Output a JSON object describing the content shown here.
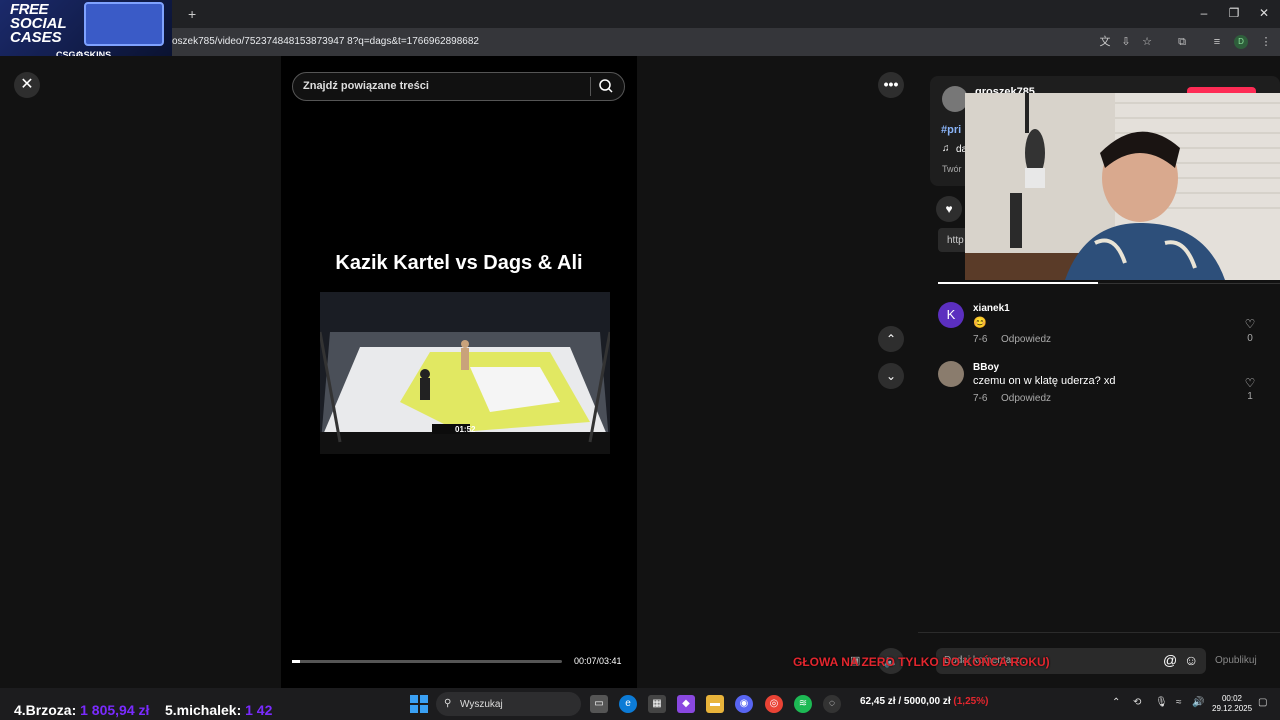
{
  "browser": {
    "url": "oszek785/video/752374848153873947 8?q=dags&t=1766962898682"
  },
  "promo": {
    "line1": "FREE",
    "line2": "SOCIAL",
    "line3": "CASES",
    "brand": "CSG⚙SKINS"
  },
  "video": {
    "search_placeholder": "Znajdź powiązane treści",
    "title": "Kazik Kartel vs Dags & Ali",
    "time": "00:07/03:41",
    "progress": 0.03,
    "scoreboard_time": "01:52"
  },
  "author": {
    "name": "groszek785",
    "hashtag": "#pri",
    "music": "da",
    "creator_label": "Twór",
    "link": "http"
  },
  "comments": [
    {
      "avatar_letter": "K",
      "avatar_color": "#5b2fbf",
      "user": "xianek1",
      "text": "😊",
      "date": "7-6",
      "reply": "Odpowiedz",
      "likes": "0"
    },
    {
      "avatar_letter": "",
      "avatar_color": "#8a7c6d",
      "user": "BBoy",
      "text": "czemu on w klatę uderza? xd",
      "date": "7-6",
      "reply": "Odpowiedz",
      "likes": "1"
    }
  ],
  "comment_box": {
    "placeholder": "Dodaj komentarz...",
    "publish": "Opublikuj"
  },
  "overlay_goal": "GŁOWA NA ZERO TYLKO DO KOŃCA ROKU)",
  "ticker": {
    "item4_label": "4.Brzoza:",
    "item4_value": "1 805,94 zł",
    "item5_label": "5.michalek:",
    "item5_value": "1 42"
  },
  "taskbar": {
    "search": "Wyszukaj",
    "balance": "62,45 zł / 5000,00 zł",
    "balance_pct": "(1,25%)",
    "time": "00:02",
    "date": "29.12.2025"
  },
  "colors": {
    "accent_red": "#fe2c55",
    "ticker_purple": "#7a2bff"
  }
}
